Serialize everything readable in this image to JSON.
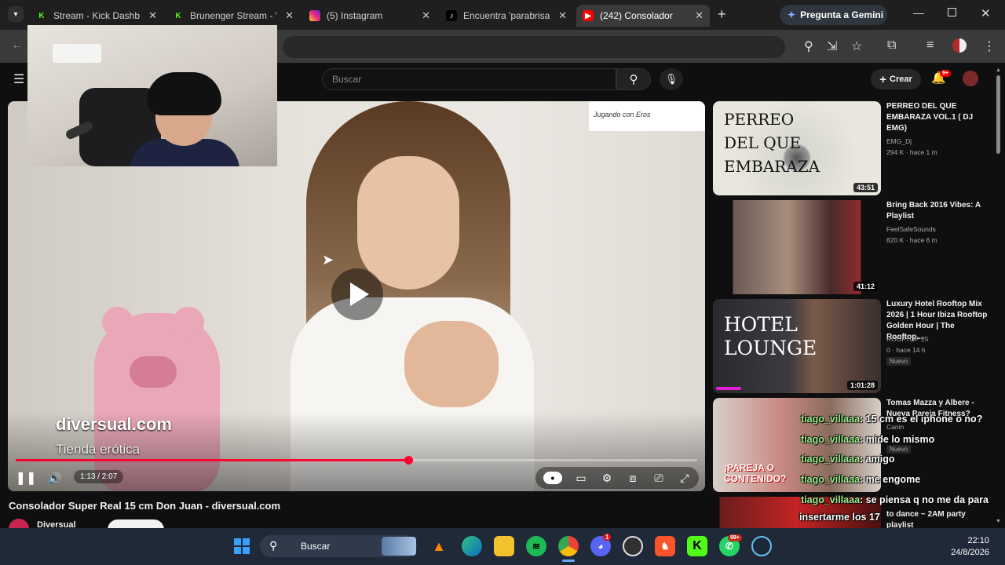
{
  "browser": {
    "tabs": [
      {
        "title": "Stream - Kick Dashbo",
        "icon": "kick-icon"
      },
      {
        "title": "Brunenger Stream - W",
        "icon": "kick-icon"
      },
      {
        "title": "(5) Instagram",
        "icon": "instagram-icon"
      },
      {
        "title": "Encuentra 'parabrisas",
        "icon": "tiktok-icon"
      },
      {
        "title": "(242) Consolador",
        "icon": "youtube-icon",
        "active": true
      }
    ],
    "gemini_label": "Pregunta a Gemini"
  },
  "youtube": {
    "search_placeholder": "Buscar",
    "create_label": "Crear",
    "notif_badge": "9+"
  },
  "video": {
    "watermark_text": "Jugando con Eros",
    "overlay_logo": "diversual.com",
    "overlay_tagline": "Tienda erótica",
    "time": "1:13 / 2:07",
    "progress_fraction": 0.576,
    "title": "Consolador Super Real 15 cm Don Juan - diversual.com",
    "channel": "Diversual"
  },
  "recommendations": [
    {
      "title": "PERREO DEL QUE EMBARAZA VOL.1 ( DJ EMG)",
      "channel": "EMG_Dj",
      "meta": "294 K · hace 1 m",
      "duration": "43:51",
      "thumb_text": "PERREO DEL QUE EMBARAZA"
    },
    {
      "title": "Bring Back 2016 Vibes: A Playlist",
      "channel": "FeelSafeSounds",
      "meta": "820 K · hace 6 m",
      "duration": "41:12"
    },
    {
      "title": "Luxury Hotel Rooftop Mix 2026 | 1 Hour Ibiza Rooftop Golden Hour | The Rooftop...",
      "channel": "ROOFTOP 25",
      "meta": "0 · hace 14 h",
      "badge": "Nuevo",
      "duration": "1:01:28",
      "thumb_text": "HOTEL LOUNGE"
    },
    {
      "title": "Tomas Mazza y Albere - Nueva Pareja Fitness?",
      "channel": "Canin",
      "badge": "Nuevo",
      "thumb_text": "¡PAREJA O CONTENIDO?"
    },
    {
      "title": "to dance ~ 2AM party playlist",
      "channel": ""
    }
  ],
  "chat": [
    {
      "user": "tiago_villaaa",
      "msg": ": 15 cm es el iphone o no?"
    },
    {
      "user": "tiago_villaaa",
      "msg": ": mide lo mismo"
    },
    {
      "user": "tiago_villaaa",
      "msg": ": amigo"
    },
    {
      "user": "tiago_villaaa",
      "msg": ": me engome"
    },
    {
      "user": "tiago_villaaa",
      "msg": ": se piensa q no me da para"
    },
    {
      "user": "",
      "msg": "insertarme los 17"
    }
  ],
  "taskbar": {
    "search_label": "Buscar",
    "time": "22:10",
    "date": "24/8/2026",
    "whatsapp_badge": "99+",
    "discord_badge": "1"
  },
  "colors": {
    "accent": "#ff0033",
    "chat_user": "#9ef08c",
    "taskbar": "#202938"
  }
}
